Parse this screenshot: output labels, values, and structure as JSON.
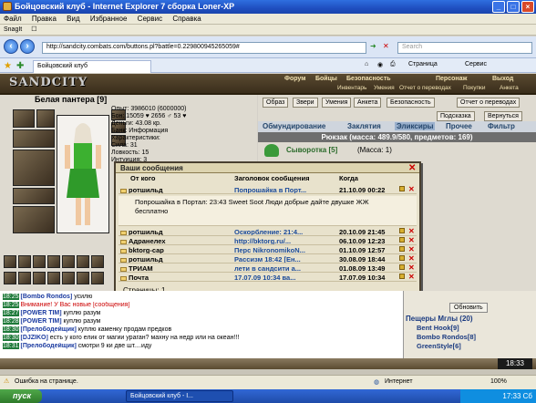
{
  "window": {
    "title": "Бойцовский клуб - Internet Explorer 7 сборка Loner-XP"
  },
  "menu": [
    "Файл",
    "Правка",
    "Вид",
    "Избранное",
    "Сервис",
    "Справка"
  ],
  "links": {
    "snagit": "SnagIt",
    "extra": "☐"
  },
  "address": {
    "url": "http://sandcity.combats.com/buttons.pl?battle=0.229800945265059#",
    "search_placeholder": "Search"
  },
  "tab": {
    "label": "Бойцовский клуб"
  },
  "toolbar": {
    "page": "Страница",
    "service": "Сервис"
  },
  "game": {
    "logo": "SANDCITY",
    "top_menu": [
      "Форум",
      "Бойцы",
      "Безопасность",
      "Персонаж",
      "Выход"
    ],
    "top_menu2": [
      "Инвентарь",
      "Умения",
      "Отчет о переводах",
      "Покупки",
      "Анкета"
    ],
    "char_name": "Белая пантера [9]",
    "stats": {
      "exp": "Опыт: 3986010 (6000000)",
      "wins": "Бон: 15059 ♥ 2656 ♂ 53 ♥",
      "money": "Деньги: 43.08 кр.",
      "bank": "Банк: Информация",
      "char_toggle": "Характеристики:",
      "strength": "Сила: 31",
      "agility": "Ловкость: 15",
      "intuition": "Интуиция: 3"
    },
    "action_buttons": [
      "Образ",
      "Звери",
      "Умения",
      "Анкета",
      "Безопасность",
      "Отчет о переводах"
    ],
    "sub_buttons": [
      "Подсказка",
      "Вернуться"
    ],
    "inv_tabs": [
      "Обмундирование",
      "Заклятия",
      "Эликсиры",
      "Прочее",
      "Фильтр"
    ],
    "rucksack": "Рюкзак (масса: 489.9/580, предметов: 169)",
    "item": {
      "name": "Сыворотка [5]",
      "mass": "(Масса: 1)"
    }
  },
  "dialog": {
    "title": "Ваши сообщения",
    "col_from": "От кого",
    "col_subject": "Заголовок сообщения",
    "col_when": "Когда",
    "messages": [
      {
        "from": "ротшильд",
        "subject": "Попрошайка в Порт...",
        "when": "21.10.09 00:22"
      },
      {
        "from": "ротшильд",
        "subject": "Оскорбление: 21:4...",
        "when": "20.10.09 21:45"
      },
      {
        "from": "Адранелех",
        "subject": "http://bktorg.ru/...",
        "when": "06.10.09 12:23"
      },
      {
        "from": "bktorg-сар",
        "subject": "Перс NikronomikoN...",
        "when": "01.10.09 12:57"
      },
      {
        "from": "ротшильд",
        "subject": "Рассизм 18:42 [Ен...",
        "when": "30.08.09 18:44"
      },
      {
        "from": "ТРИАМ",
        "subject": "лети в сандсити а...",
        "when": "01.08.09 13:49"
      },
      {
        "from": "Почта",
        "subject": "17.07.09 10:34 ва...",
        "when": "17.07.09 10:34"
      }
    ],
    "expanded": "Попрошайка в Портал: 23:43 Sweet Soot Люди добрые дайте двушке ЖЖ бесплатно",
    "pages": "Страницы: 1"
  },
  "chat": [
    {
      "time": "18:25",
      "nick": "[Bombo Rondos]",
      "text": " усилю"
    },
    {
      "time": "18:25",
      "nick": "",
      "text": "Внимание! У Вас новые [сообщения]",
      "alert": true
    },
    {
      "time": "18:27",
      "nick": "[POWER TIM]",
      "text": " куплю разум"
    },
    {
      "time": "18:28",
      "nick": "[POWER TIM]",
      "text": " куплю разум"
    },
    {
      "time": "18:30",
      "nick": "[Прелободейщик]",
      "text": " куплю каменку продам предков"
    },
    {
      "time": "18:30",
      "nick": "[DJZIKO]",
      "text": " есть у кого елик от магии ураган? махну на недр или на океан!!!"
    },
    {
      "time": "18:31",
      "nick": "[Прелободейщик]",
      "text": " смотри 9 ки две шт....иду"
    }
  ],
  "online": {
    "refresh": "Обновить",
    "header": "Пещеры Мглы (20)",
    "users": [
      "Bent Hook[9]",
      "Bombo Rondos[8]",
      "GreenStyle[6]"
    ]
  },
  "status": {
    "text": "Ошибка на странице.",
    "zone": "Интернет",
    "zoom": "100%"
  },
  "taskbar": {
    "start": "пуск",
    "task": "Бойцовский клуб - I...",
    "clock": "17:33 Сб"
  },
  "game_clock": "18:33"
}
